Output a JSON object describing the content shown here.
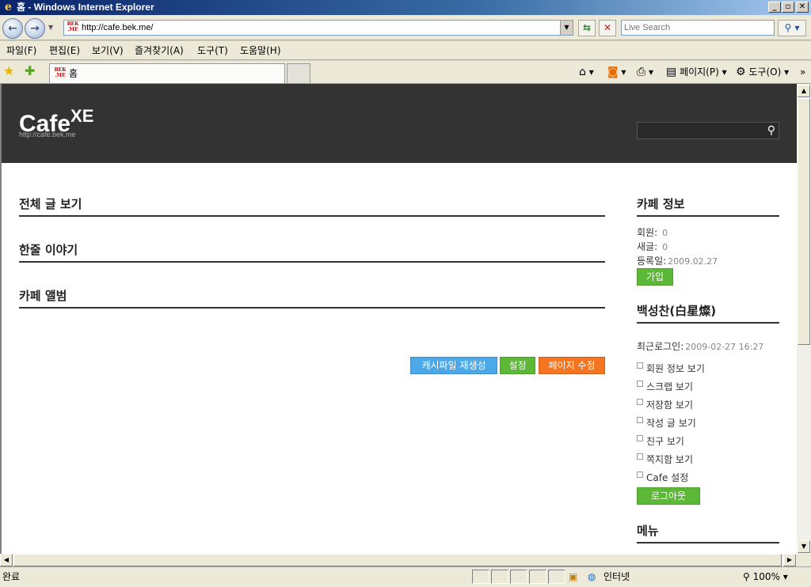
{
  "window": {
    "title": "홈 - Windows Internet Explorer",
    "minimize": "_",
    "restore": "▫",
    "close": "✕"
  },
  "address": {
    "url": "http://cafe.bek.me/",
    "favicon_text": "BEK .ME",
    "search_placeholder": "Live Search"
  },
  "menu": [
    "파일(F)",
    "편집(E)",
    "보기(V)",
    "즐겨찾기(A)",
    "도구(T)",
    "도움말(H)"
  ],
  "tab": {
    "label": "홈"
  },
  "commands": {
    "page": "페이지(P)",
    "tools": "도구(O)"
  },
  "site": {
    "logo": "Cafe",
    "logo_sup": "XE",
    "logo_url": "http://cafe.bek.me"
  },
  "main": {
    "sections": [
      "전체 글 보기",
      "한줄 이야기",
      "카페 앨범"
    ],
    "buttons": {
      "cache": "캐시파일 재생성",
      "settings": "설정",
      "edit_page": "페이지 수정"
    }
  },
  "sidebar": {
    "cafe_info_title": "카페 정보",
    "members_label": "회원:",
    "members_value": "0",
    "new_posts_label": "새글:",
    "new_posts_value": "0",
    "registered_label": "등록일:",
    "registered_value": "2009.02.27",
    "join_button": "가입",
    "user_title": "백성찬(白星燦)",
    "last_login_label": "최근로그인:",
    "last_login_value": "2009-02-27 16:27",
    "links": [
      "회원 정보 보기",
      "스크랩 보기",
      "저장함 보기",
      "작성 글 보기",
      "친구 보기",
      "쪽지함 보기",
      "Cafe 설정"
    ],
    "logout_button": "로그아웃",
    "menu_title": "메뉴"
  },
  "status": {
    "text": "완료",
    "zone": "인터넷",
    "zoom": "100%"
  }
}
